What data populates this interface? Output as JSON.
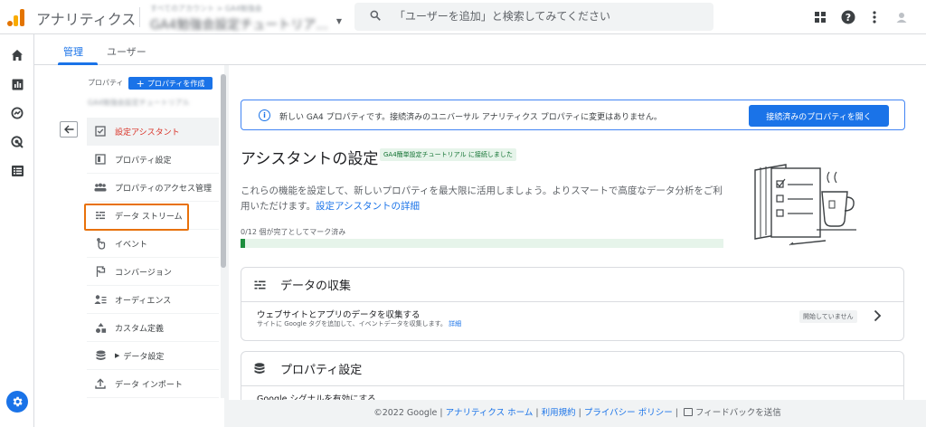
{
  "app": {
    "title": "アナリティクス"
  },
  "account": {
    "line1": "すべてのアカウント > GA4勉強会",
    "line2": "GA4勉強会設定チュートリア..."
  },
  "search": {
    "placeholder": "「ユーザーを追加」と検索してみてください"
  },
  "tabs": [
    {
      "label": "管理",
      "active": true
    },
    {
      "label": "ユーザー",
      "active": false
    }
  ],
  "admin": {
    "property_label": "プロパティ",
    "create_label": "プロパティを作成",
    "property_name": "GA4勉強会設定チュートリアル",
    "menu": [
      {
        "label": "設定アシスタント",
        "icon": "checklist-icon",
        "active": true
      },
      {
        "label": "プロパティ設定",
        "icon": "property-settings-icon"
      },
      {
        "label": "プロパティのアクセス管理",
        "icon": "people-icon"
      },
      {
        "label": "データ ストリーム",
        "icon": "data-stream-icon",
        "highlight": true
      },
      {
        "label": "イベント",
        "icon": "events-icon"
      },
      {
        "label": "コンバージョン",
        "icon": "flag-icon"
      },
      {
        "label": "オーディエンス",
        "icon": "audience-icon"
      },
      {
        "label": "カスタム定義",
        "icon": "custom-definitions-icon"
      },
      {
        "label": "データ設定",
        "icon": "database-icon",
        "expandable": true
      },
      {
        "label": "データ インポート",
        "icon": "upload-icon"
      }
    ]
  },
  "banner": {
    "text": "新しい GA4 プロパティです。接続済みのユニバーサル アナリティクス プロパティに変更はありません。",
    "button": "接続済みのプロパティを開く"
  },
  "assistant": {
    "title": "アシスタントの設定",
    "badge": "GA4簡単設定チュートリアル に接続しました",
    "description": "これらの機能を設定して、新しいプロパティを最大限に活用しましょう。よりスマートで高度なデータ分析をご利用いただけます。",
    "link": "設定アシスタントの詳細",
    "progress_label": "0/12 個が完了としてマーク済み",
    "progress_value": 0.01
  },
  "cards": [
    {
      "title": "データの収集",
      "icon": "data-collection-icon",
      "row_title": "ウェブサイトとアプリのデータを収集する",
      "row_sub": "サイトに Google タグを追加して、イベントデータを収集します。",
      "row_link": "詳細",
      "status": "開始していません"
    },
    {
      "title": "プロパティ設定",
      "icon": "database-icon",
      "row_title": "Google シグナルを有効にする"
    }
  ],
  "footer": {
    "copyright": "©2022 Google",
    "links": [
      "アナリティクス ホーム",
      "利用規約",
      "プライバシー ポリシー"
    ],
    "feedback": "フィードバックを送信"
  },
  "colors": {
    "accent": "#1a73e8",
    "highlight": "#e8710a",
    "active_item": "#d93025",
    "progress": "#1e8e3e"
  }
}
